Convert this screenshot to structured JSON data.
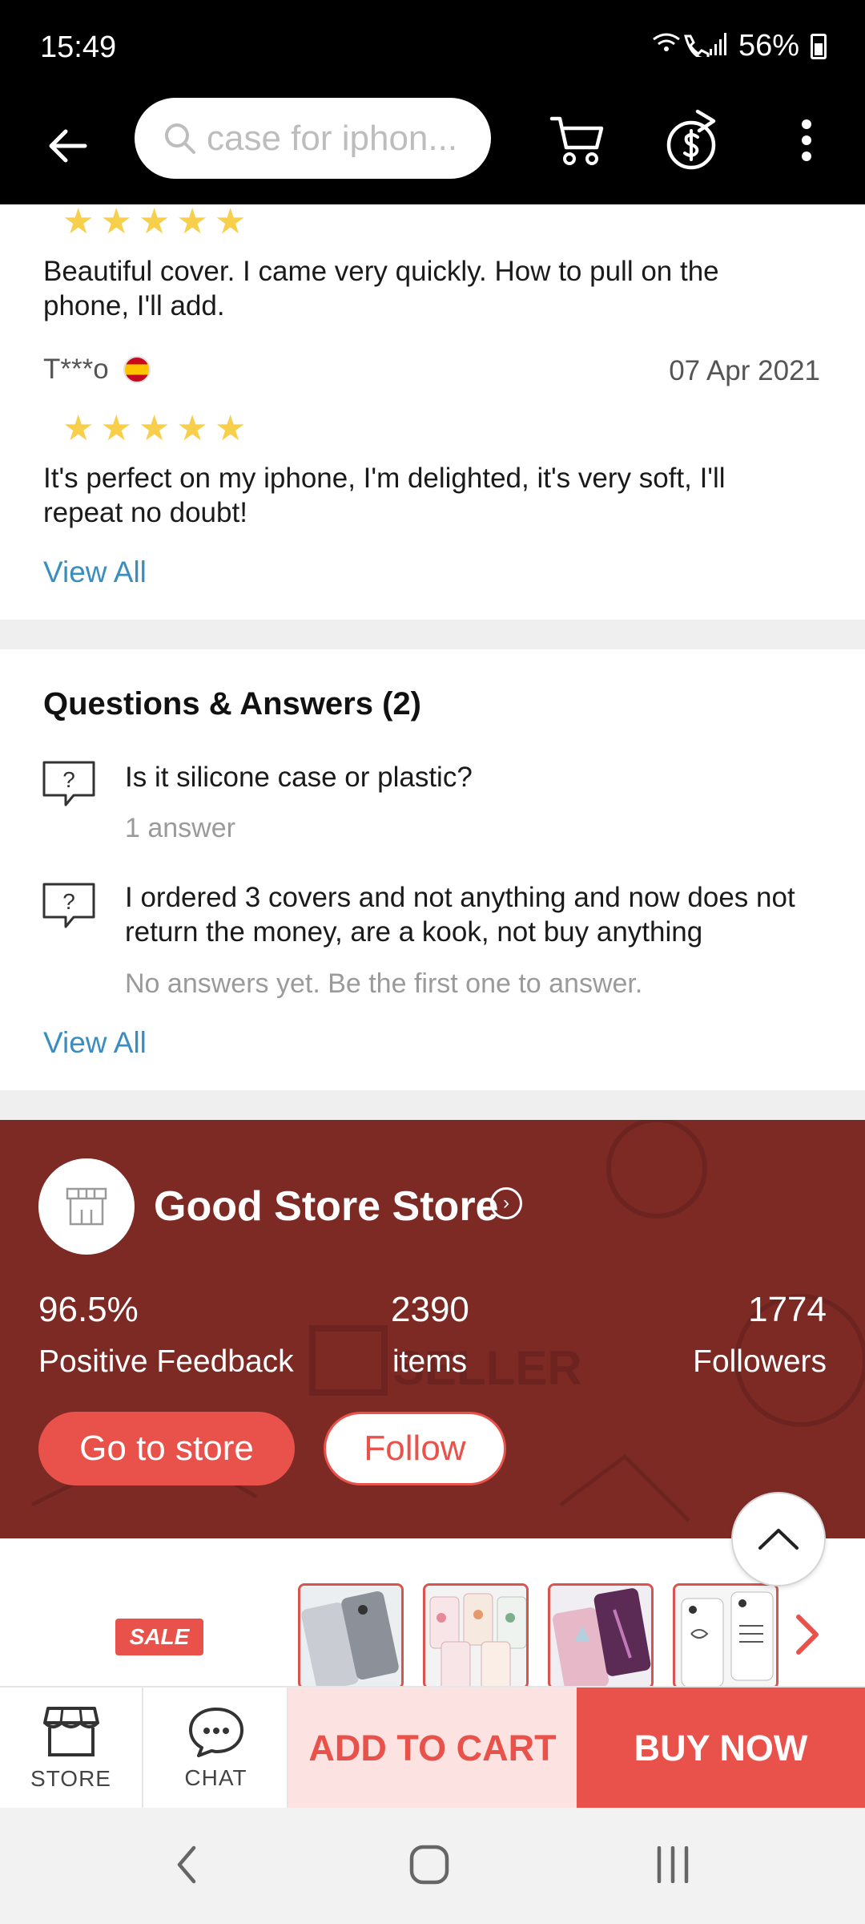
{
  "status_bar": {
    "time": "15:49",
    "battery": "56%"
  },
  "app_bar": {
    "search_placeholder": "case for iphon..."
  },
  "reviews": {
    "items": [
      {
        "stars": 5,
        "text": "Beautiful cover. I came very quickly. How to pull on the phone, I'll add."
      },
      {
        "reviewer": "T***o",
        "date": "07 Apr 2021",
        "stars": 5,
        "text": "It's perfect on my iphone, I'm delighted, it's very soft, I'll repeat no doubt!"
      }
    ],
    "view_all": "View All"
  },
  "qa": {
    "title": "Questions & Answers (2)",
    "items": [
      {
        "question": "Is it silicone case or plastic?",
        "answers": "1 answer"
      },
      {
        "question": "I ordered 3 covers and not anything and now does not return the money, are a kook, not buy anything",
        "answers": "No answers yet. Be the first one to answer."
      }
    ],
    "view_all": "View All"
  },
  "store": {
    "name": "Good Store Store",
    "stats": [
      {
        "value": "96.5%",
        "label": "Positive Feedback"
      },
      {
        "value": "2390",
        "label": "items"
      },
      {
        "value": "1774",
        "label": "Followers"
      }
    ],
    "go_label": "Go to store",
    "follow_label": "Follow"
  },
  "strip": {
    "sale_label": "SALE"
  },
  "actions": {
    "store_label": "STORE",
    "chat_label": "CHAT",
    "add_to_cart": "ADD TO CART",
    "buy_now": "BUY NOW"
  },
  "colors": {
    "accent": "#e8524b",
    "store_bg": "#7d2a25",
    "link": "#3a8dbf",
    "star": "#f7cf4a"
  }
}
